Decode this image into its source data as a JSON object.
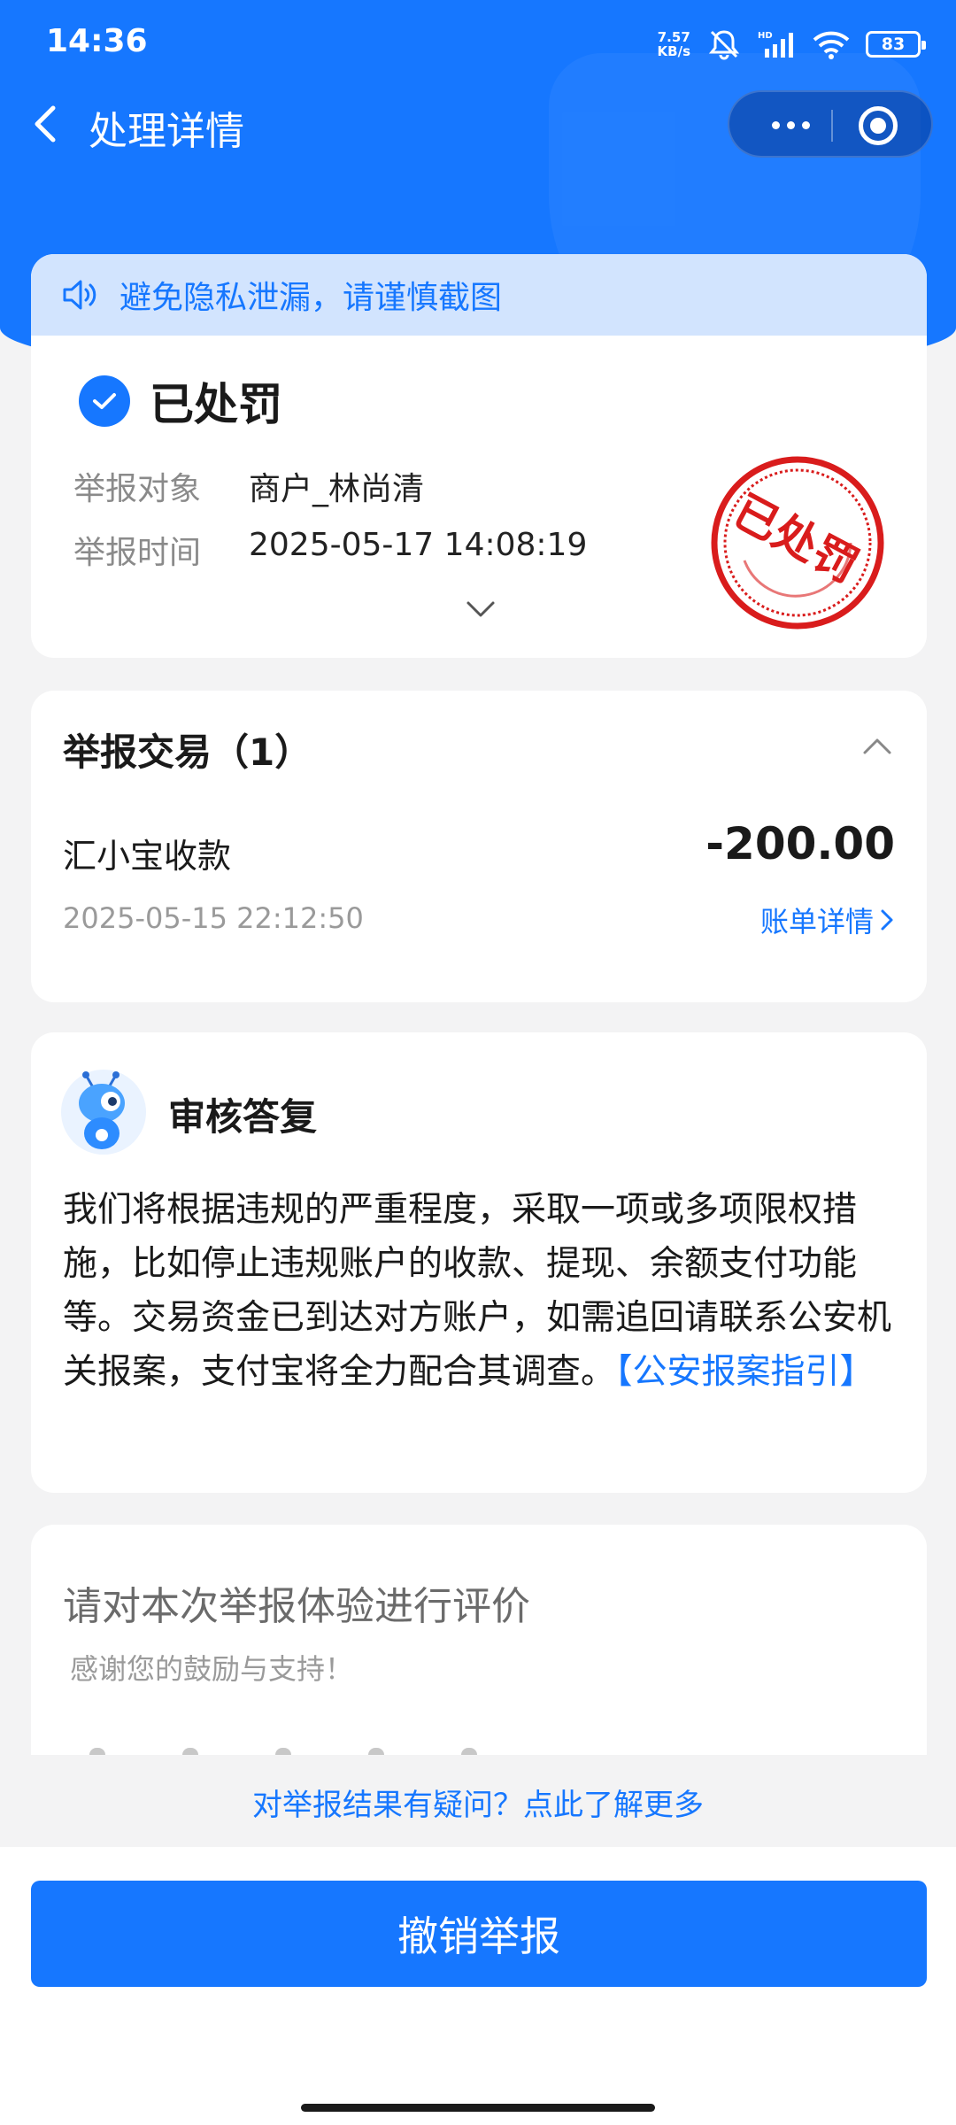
{
  "status_bar": {
    "time": "14:36",
    "net_speed_value": "7.57",
    "net_speed_unit": "KB/s",
    "battery": "83"
  },
  "nav": {
    "title": "处理详情"
  },
  "notice": {
    "text": "避免隐私泄漏，请谨慎截图"
  },
  "report": {
    "status": "已处罚",
    "rows": [
      {
        "label": "举报对象",
        "value": "商户_林尚清"
      },
      {
        "label": "举报时间",
        "value": "2025-05-17 14:08:19"
      }
    ],
    "stamp_text": "已处罚"
  },
  "transactions": {
    "title": "举报交易（1）",
    "items": [
      {
        "name": "汇小宝收款",
        "amount": "-200.00",
        "date": "2025-05-15 22:12:50",
        "link": "账单详情"
      }
    ]
  },
  "review": {
    "title": "审核答复",
    "body": "我们将根据违规的严重程度，采取一项或多项限权措施，比如停止违规账户的收款、提现、余额支付功能等。交易资金已到达对方账户，如需追回请联系公安机关报案，支付宝将全力配合其调查。",
    "link": "【公安报案指引】"
  },
  "rating": {
    "title": "请对本次举报体验进行评价",
    "subtitle": "感谢您的鼓励与支持！"
  },
  "footer": {
    "question_link": "对举报结果有疑问？点此了解更多",
    "cancel_button": "撤销举报"
  },
  "colors": {
    "primary": "#1677ff",
    "notice_bg": "#d2e4fe",
    "stamp": "#d91c1c",
    "page_bg": "#f3f3f4"
  }
}
